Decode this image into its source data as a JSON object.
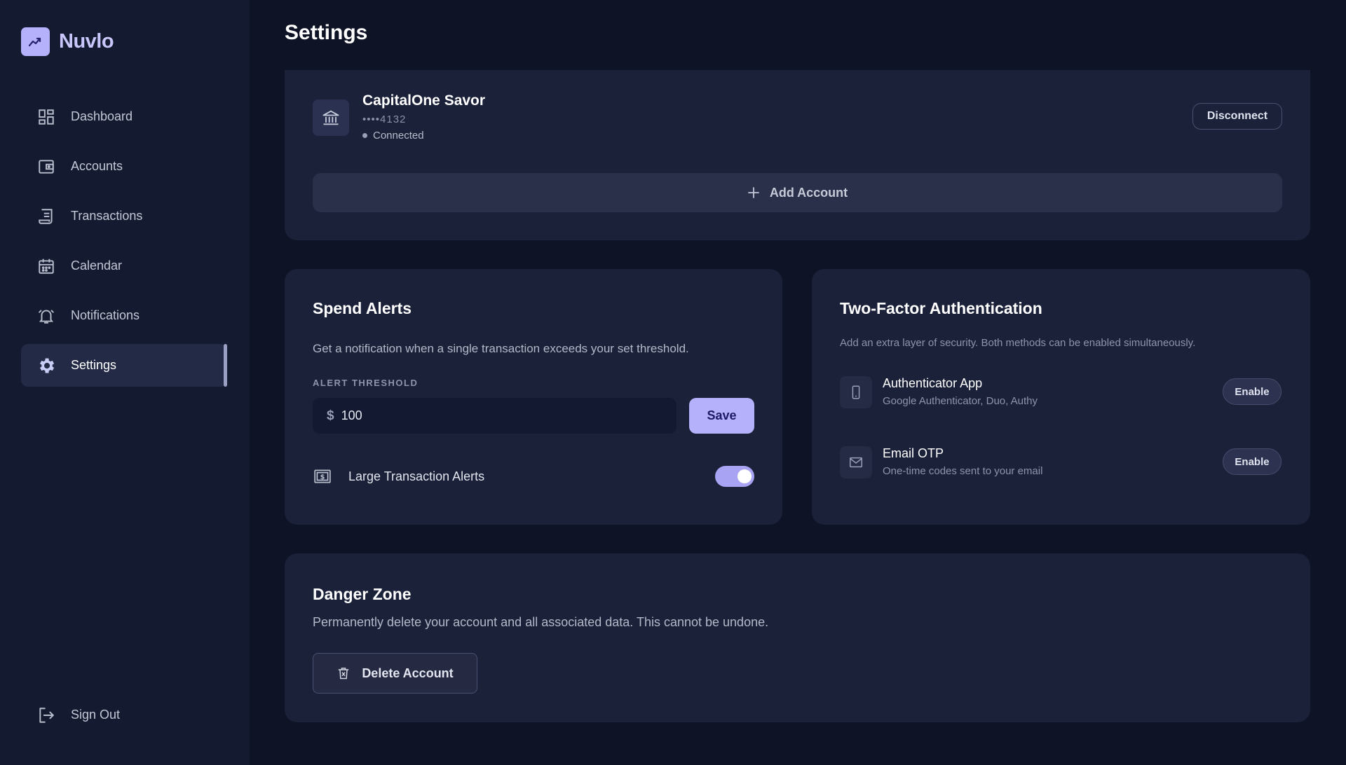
{
  "brand": {
    "name": "Nuvlo"
  },
  "sidebar": {
    "items": [
      {
        "label": "Dashboard",
        "icon": "dashboard-icon"
      },
      {
        "label": "Accounts",
        "icon": "wallet-icon"
      },
      {
        "label": "Transactions",
        "icon": "receipt-icon"
      },
      {
        "label": "Calendar",
        "icon": "calendar-icon"
      },
      {
        "label": "Notifications",
        "icon": "bell-icon"
      },
      {
        "label": "Settings",
        "icon": "gear-icon",
        "active": true
      }
    ],
    "signout_label": "Sign Out"
  },
  "page": {
    "title": "Settings"
  },
  "accounts": {
    "item": {
      "name": "CapitalOne Savor",
      "mask": "••••4132",
      "status": "Connected"
    },
    "disconnect_label": "Disconnect",
    "add_label": "Add Account"
  },
  "spend_alerts": {
    "title": "Spend Alerts",
    "description": "Get a notification when a single transaction exceeds your set threshold.",
    "threshold_label": "ALERT THRESHOLD",
    "currency": "$",
    "threshold_value": "100",
    "save_label": "Save",
    "large_alerts_label": "Large Transaction Alerts",
    "large_alerts_enabled": true
  },
  "two_factor": {
    "title": "Two-Factor Authentication",
    "description": "Add an extra layer of security. Both methods can be enabled simultaneously.",
    "methods": [
      {
        "title": "Authenticator App",
        "subtitle": "Google Authenticator, Duo, Authy",
        "button": "Enable",
        "icon": "phone-icon"
      },
      {
        "title": "Email OTP",
        "subtitle": "One-time codes sent to your email",
        "button": "Enable",
        "icon": "mail-icon"
      }
    ]
  },
  "danger_zone": {
    "title": "Danger Zone",
    "description": "Permanently delete your account and all associated data. This cannot be undone.",
    "delete_label": "Delete Account"
  },
  "colors": {
    "accent": "#b5b1fb",
    "background": "#0e1326",
    "sidebar": "#141a30",
    "card": "#1b2139"
  }
}
